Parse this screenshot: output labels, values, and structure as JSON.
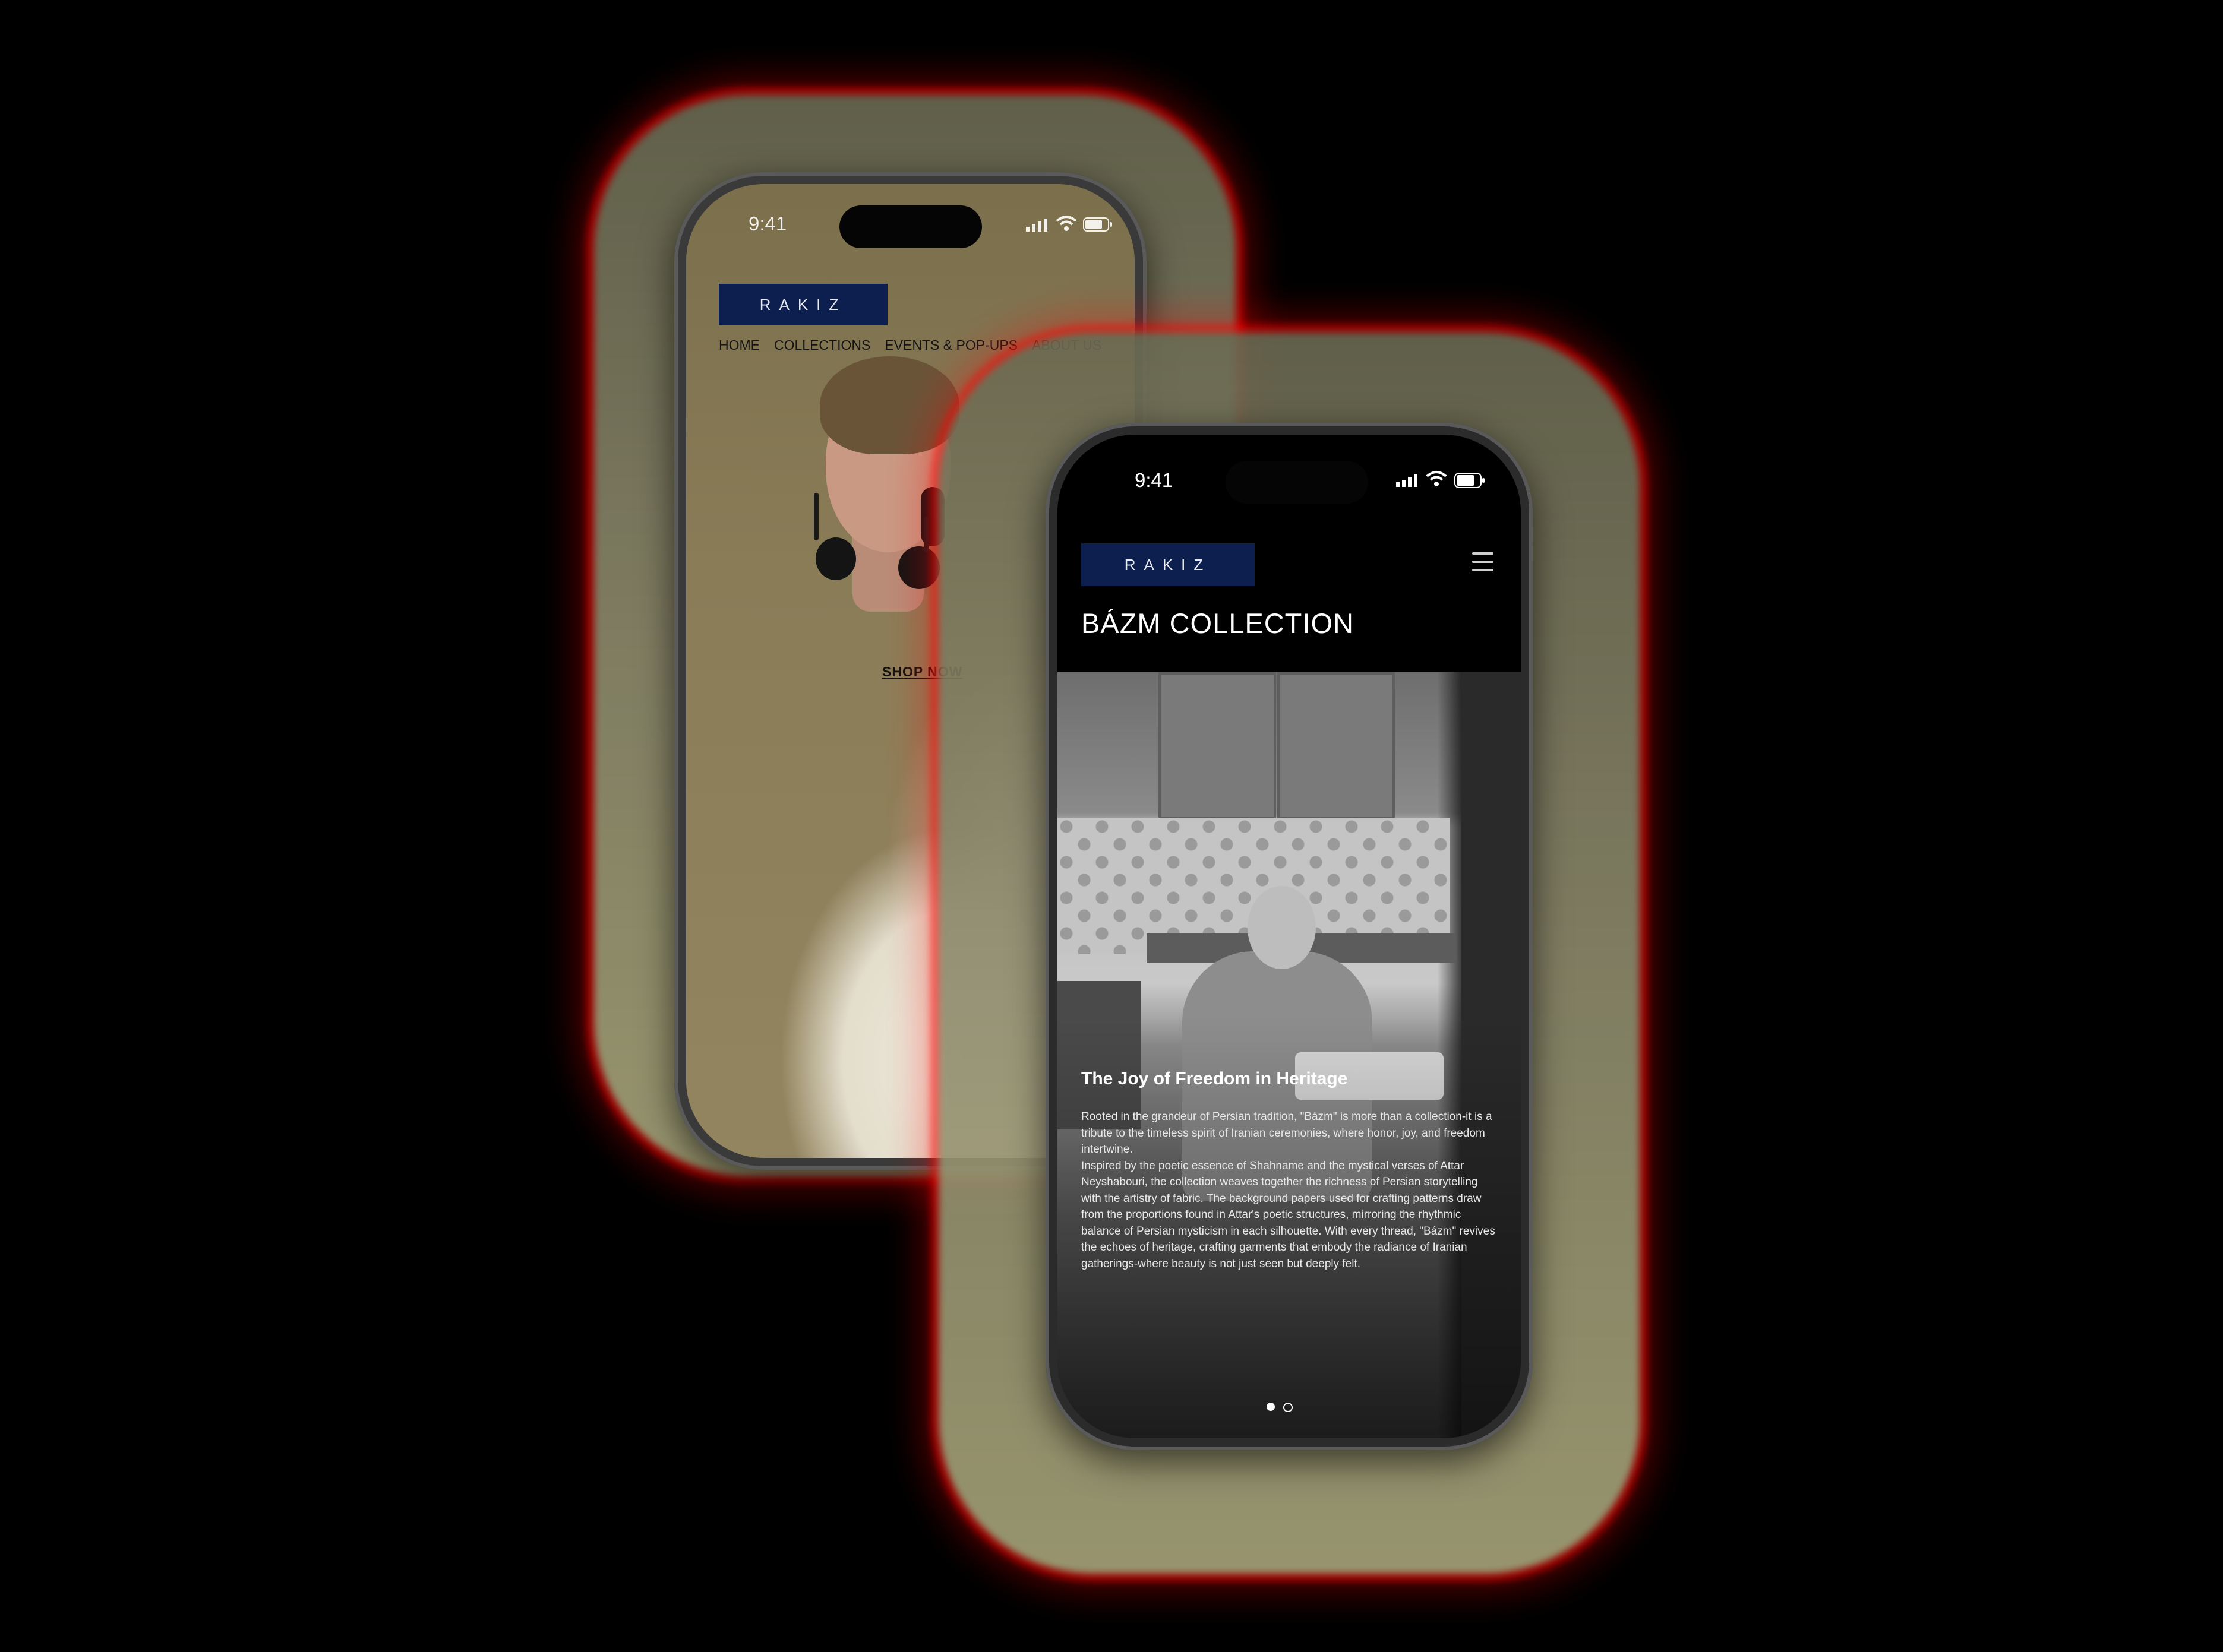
{
  "front_phone": {
    "status": {
      "time": "9:41"
    },
    "brand": {
      "logo_text": "RAKIZ",
      "color": "#0d1f4f"
    },
    "nav": [
      {
        "label": "HOME"
      },
      {
        "label": "COLLECTIONS"
      },
      {
        "label": "EVENTS & POP-UPS"
      },
      {
        "label": "ABOUT US"
      }
    ],
    "cta": {
      "label": "SHOP NOW"
    }
  },
  "back_phone": {
    "status": {
      "time": "9:41"
    },
    "brand": {
      "logo_text": "RAKIZ",
      "color": "#0d1f4f"
    },
    "menu_icon": "hamburger-icon",
    "page_title": "BÁZM COLLECTION",
    "story": {
      "heading": "The Joy of Freedom in Heritage",
      "paragraph_1": "Rooted in the grandeur of Persian tradition, \"Bázm\" is more than a collection-it is a tribute to the timeless spirit of Iranian ceremonies, where honor, joy, and freedom intertwine.",
      "paragraph_2": "Inspired by the poetic essence of Shahname and the mystical verses of Attar Neyshabouri, the collection weaves together the richness of Persian storytelling with the artistry of fabric. The background papers used for crafting patterns draw from the proportions found in Attar's poetic structures, mirroring the rhythmic balance of Persian mysticism in each silhouette. With every thread, \"Bázm\" revives the echoes of heritage, crafting garments that embody the radiance of Iranian gatherings-where beauty is not just seen but deeply felt."
    },
    "carousel": {
      "slides": 2,
      "active": 1
    }
  }
}
